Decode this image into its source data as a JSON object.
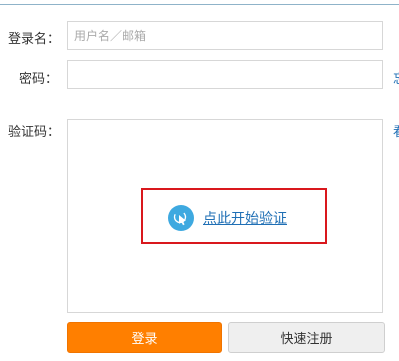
{
  "form": {
    "username": {
      "label": "登录名：",
      "placeholder": "用户名／邮箱",
      "value": ""
    },
    "password": {
      "label": "密码：",
      "value": "",
      "side_link": "忘"
    },
    "captcha": {
      "label": "验证码：",
      "side_link": "看",
      "verify_label": "点此开始验证"
    }
  },
  "buttons": {
    "login": "登录",
    "register": "快速注册"
  },
  "colors": {
    "primary_button": "#ff7f00",
    "link": "#1f6fb5",
    "highlight_border": "#d9181d",
    "verify_icon": "#3ea9e0"
  }
}
